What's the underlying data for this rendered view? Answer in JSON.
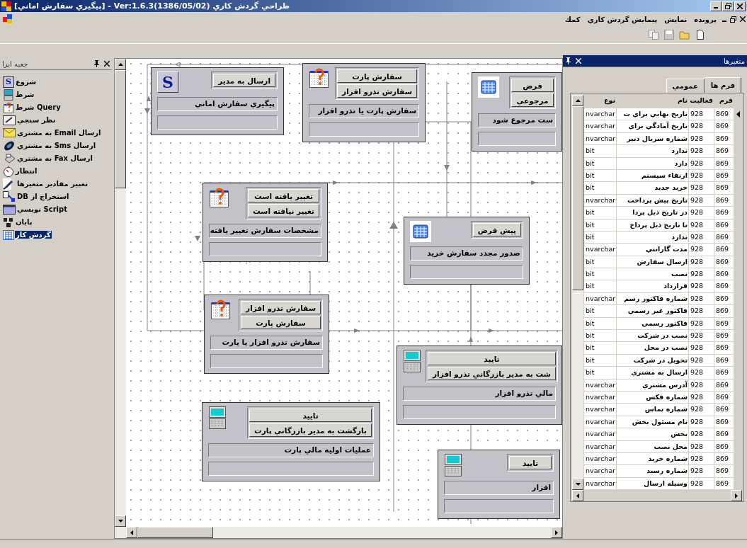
{
  "window": {
    "title": "طراحي گردش كاري Ver:1.6.3(1386/05/02) - [پيگيري سفارش اماني]"
  },
  "menu": [
    {
      "label": "پرونده"
    },
    {
      "label": "نمايش"
    },
    {
      "label": "پيمايش گردش كاري"
    },
    {
      "label": "كمك"
    }
  ],
  "toolbox": {
    "title": "جعبه ابزا",
    "items": [
      {
        "label": "شروع",
        "kind": "start",
        "icon_label": "S",
        "selected": false
      },
      {
        "label": "شرط",
        "kind": "condition",
        "selected": false
      },
      {
        "label": "Query شرط",
        "kind": "query",
        "selected": false
      },
      {
        "label": "نظر سنجي",
        "kind": "poll",
        "selected": false
      },
      {
        "label": "ارسال Email به مشتري",
        "kind": "email",
        "selected": false
      },
      {
        "label": "ارسال Sms به مشتري",
        "kind": "sms",
        "selected": false
      },
      {
        "label": "ارسال Fax به مشتري",
        "kind": "fax",
        "selected": false
      },
      {
        "label": "انتظار",
        "kind": "wait",
        "selected": false
      },
      {
        "label": "تغيير مقادير متغيرها",
        "kind": "variables",
        "selected": false
      },
      {
        "label": "استخراج از DB",
        "kind": "db",
        "selected": false
      },
      {
        "label": "Script نويسي",
        "kind": "script",
        "selected": false
      },
      {
        "label": "پايان",
        "kind": "end",
        "selected": false
      },
      {
        "label": "گردش كار",
        "kind": "workflow",
        "selected": true
      }
    ]
  },
  "canvas": {
    "nodes": [
      {
        "kind": "form",
        "buttons": [
          "فرض",
          "مرجوعي"
        ],
        "label": "ست مرجوع شود"
      },
      {
        "kind": "query",
        "buttons": [
          "سفارش پارت",
          "سفارش تذرو افزار"
        ],
        "label": "سفارش پارت يا تذرو افزار"
      },
      {
        "kind": "start",
        "icon_label": "S",
        "buttons": [
          "ارسال به مدير"
        ],
        "label": "پيگيري سفارش اماني"
      },
      {
        "kind": "form",
        "buttons": [
          "پيش فرض"
        ],
        "label": "صدور مجدد سفارش خريد"
      },
      {
        "kind": "query",
        "buttons": [
          "تغيير يافته است",
          "تغيير نيافته است"
        ],
        "label": "مشخصات سفارش تغيير يافته"
      },
      {
        "kind": "terminal",
        "buttons": [
          "تاييد",
          "شت به مدير بازرگاني تذرو افزار"
        ],
        "label": "مالي تذرو افزار"
      },
      {
        "kind": "query",
        "buttons": [
          "سفارش تذرو افزار",
          "سفارش پارت"
        ],
        "label": "سفارش تذرو افزار يا پارت"
      },
      {
        "kind": "terminal",
        "buttons": [
          "تاييد"
        ],
        "label": "افزار"
      },
      {
        "kind": "terminal",
        "buttons": [
          "تاييد",
          "بازگشت به مدير بازرگاني پارت"
        ],
        "label": "عمليات اوليه مالي پارت"
      }
    ]
  },
  "variables": {
    "title": "متغيرها",
    "tabs": [
      {
        "label": "فرم ها",
        "selected": true
      },
      {
        "label": "عمومي",
        "selected": false
      }
    ],
    "columns": [
      "فرم",
      "فعاليت",
      "نام",
      "نوع"
    ],
    "rows": [
      {
        "form": "869",
        "activity": "928",
        "name": "تاريخ نهايي براي ت",
        "type": "nvarchar",
        "selected": true
      },
      {
        "form": "869",
        "activity": "928",
        "name": "تاريخ آمادگي براي",
        "type": "nvarchar",
        "selected": false
      },
      {
        "form": "869",
        "activity": "928",
        "name": "شماره سريال دبير",
        "type": "nvarchar",
        "selected": false
      },
      {
        "form": "869",
        "activity": "928",
        "name": "ندارد",
        "type": "bit",
        "selected": false
      },
      {
        "form": "869",
        "activity": "928",
        "name": "دارد",
        "type": "bit",
        "selected": false
      },
      {
        "form": "869",
        "activity": "928",
        "name": "ارتقاء سيستم",
        "type": "bit",
        "selected": false
      },
      {
        "form": "869",
        "activity": "928",
        "name": "خريد جديد",
        "type": "bit",
        "selected": false
      },
      {
        "form": "869",
        "activity": "928",
        "name": "تاريخ پيش پرداخت",
        "type": "nvarchar",
        "selected": false
      },
      {
        "form": "869",
        "activity": "928",
        "name": "در تاريخ ذيل پردا",
        "type": "bit",
        "selected": false
      },
      {
        "form": "869",
        "activity": "928",
        "name": "تا تاريخ ذيل پرداخ",
        "type": "bit",
        "selected": false
      },
      {
        "form": "869",
        "activity": "928",
        "name": "ندارد",
        "type": "bit",
        "selected": false
      },
      {
        "form": "869",
        "activity": "928",
        "name": "مدت گارانتي",
        "type": "nvarchar",
        "selected": false
      },
      {
        "form": "869",
        "activity": "928",
        "name": "ارسال سفارش",
        "type": "bit",
        "selected": false
      },
      {
        "form": "869",
        "activity": "928",
        "name": "نصب",
        "type": "bit",
        "selected": false
      },
      {
        "form": "869",
        "activity": "928",
        "name": "قرارداد",
        "type": "bit",
        "selected": false
      },
      {
        "form": "869",
        "activity": "928",
        "name": "شماره فاكتور رسم",
        "type": "nvarchar",
        "selected": false
      },
      {
        "form": "869",
        "activity": "928",
        "name": "فاكتور غير رسمي",
        "type": "bit",
        "selected": false
      },
      {
        "form": "869",
        "activity": "928",
        "name": "فاكتور رسمي",
        "type": "bit",
        "selected": false
      },
      {
        "form": "869",
        "activity": "928",
        "name": "نصب در شركت",
        "type": "bit",
        "selected": false
      },
      {
        "form": "869",
        "activity": "928",
        "name": "نصب در محل",
        "type": "bit",
        "selected": false
      },
      {
        "form": "869",
        "activity": "928",
        "name": "تحويل در شركت",
        "type": "bit",
        "selected": false
      },
      {
        "form": "869",
        "activity": "928",
        "name": "ارسال به مشتري",
        "type": "bit",
        "selected": false
      },
      {
        "form": "869",
        "activity": "928",
        "name": "آدرس مشتري",
        "type": "nvarchar",
        "selected": false
      },
      {
        "form": "869",
        "activity": "928",
        "name": "شماره فكس",
        "type": "nvarchar",
        "selected": false
      },
      {
        "form": "869",
        "activity": "928",
        "name": "شماره تماس",
        "type": "nvarchar",
        "selected": false
      },
      {
        "form": "869",
        "activity": "928",
        "name": "نام مسئول بخش",
        "type": "nvarchar",
        "selected": false
      },
      {
        "form": "869",
        "activity": "928",
        "name": "بخش",
        "type": "nvarchar",
        "selected": false
      },
      {
        "form": "869",
        "activity": "928",
        "name": "محل نصب",
        "type": "nvarchar",
        "selected": false
      },
      {
        "form": "869",
        "activity": "928",
        "name": "شماره خريد",
        "type": "nvarchar",
        "selected": false
      },
      {
        "form": "869",
        "activity": "928",
        "name": "شماره رسيد",
        "type": "nvarchar",
        "selected": false
      },
      {
        "form": "869",
        "activity": "928",
        "name": "وسيله ارسال",
        "type": "nvarchar",
        "selected": false
      }
    ]
  }
}
